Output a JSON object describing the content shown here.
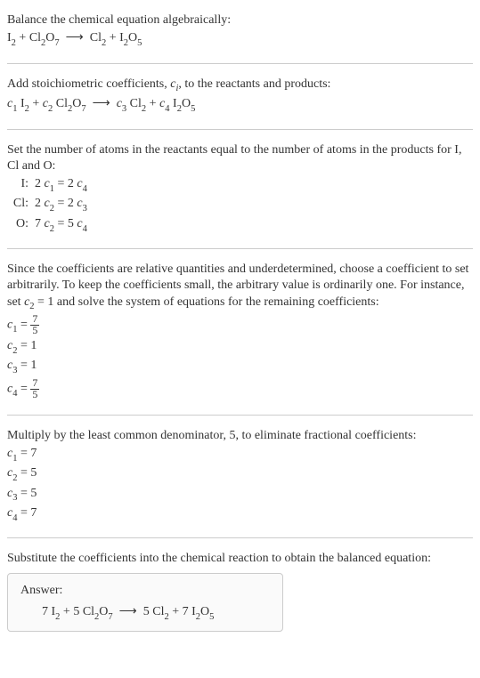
{
  "s1": {
    "intro": "Balance the chemical equation algebraically:",
    "eq_html": "I<span class=\"sub\">2</span> + Cl<span class=\"sub\">2</span>O<span class=\"sub\">7</span> &nbsp;⟶&nbsp; Cl<span class=\"sub\">2</span> + I<span class=\"sub\">2</span>O<span class=\"sub\">5</span>"
  },
  "s2": {
    "intro_html": "Add stoichiometric coefficients, <span class=\"italic\">c<span class=\"sub\">i</span></span>, to the reactants and products:",
    "eq_html": "<span class=\"italic\">c</span><span class=\"sub\">1</span> I<span class=\"sub\">2</span> + <span class=\"italic\">c</span><span class=\"sub\">2</span> Cl<span class=\"sub\">2</span>O<span class=\"sub\">7</span> &nbsp;⟶&nbsp; <span class=\"italic\">c</span><span class=\"sub\">3</span> Cl<span class=\"sub\">2</span> + <span class=\"italic\">c</span><span class=\"sub\">4</span> I<span class=\"sub\">2</span>O<span class=\"sub\">5</span>"
  },
  "s3": {
    "intro": "Set the number of atoms in the reactants equal to the number of atoms in the products for I, Cl and O:",
    "lines": [
      {
        "label": "I:",
        "rhs_html": "2 <span class=\"italic\">c</span><span class=\"sub\">1</span> = 2 <span class=\"italic\">c</span><span class=\"sub\">4</span>"
      },
      {
        "label": "Cl:",
        "rhs_html": "2 <span class=\"italic\">c</span><span class=\"sub\">2</span> = 2 <span class=\"italic\">c</span><span class=\"sub\">3</span>"
      },
      {
        "label": "O:",
        "rhs_html": "7 <span class=\"italic\">c</span><span class=\"sub\">2</span> = 5 <span class=\"italic\">c</span><span class=\"sub\">4</span>"
      }
    ]
  },
  "s4": {
    "intro_html": "Since the coefficients are relative quantities and underdetermined, choose a coefficient to set arbitrarily. To keep the coefficients small, the arbitrary value is ordinarily one. For instance, set <span class=\"italic\">c</span><span class=\"sub\">2</span> = 1 and solve the system of equations for the remaining coefficients:",
    "lines": [
      {
        "lhs_html": "<span class=\"italic\">c</span><span class=\"sub\">1</span> = <span class=\"frac\"><span class=\"num\">7</span><span class=\"den\">5</span></span>"
      },
      {
        "lhs_html": "<span class=\"italic\">c</span><span class=\"sub\">2</span> = 1"
      },
      {
        "lhs_html": "<span class=\"italic\">c</span><span class=\"sub\">3</span> = 1"
      },
      {
        "lhs_html": "<span class=\"italic\">c</span><span class=\"sub\">4</span> = <span class=\"frac\"><span class=\"num\">7</span><span class=\"den\">5</span></span>"
      }
    ]
  },
  "s5": {
    "intro": "Multiply by the least common denominator, 5, to eliminate fractional coefficients:",
    "lines": [
      {
        "lhs_html": "<span class=\"italic\">c</span><span class=\"sub\">1</span> = 7"
      },
      {
        "lhs_html": "<span class=\"italic\">c</span><span class=\"sub\">2</span> = 5"
      },
      {
        "lhs_html": "<span class=\"italic\">c</span><span class=\"sub\">3</span> = 5"
      },
      {
        "lhs_html": "<span class=\"italic\">c</span><span class=\"sub\">4</span> = 7"
      }
    ]
  },
  "s6": {
    "intro": "Substitute the coefficients into the chemical reaction to obtain the balanced equation:",
    "answer_label": "Answer:",
    "answer_html": "7 I<span class=\"sub\">2</span> + 5 Cl<span class=\"sub\">2</span>O<span class=\"sub\">7</span> &nbsp;⟶&nbsp; 5 Cl<span class=\"sub\">2</span> + 7 I<span class=\"sub\">2</span>O<span class=\"sub\">5</span>"
  },
  "chart_data": {
    "type": "table",
    "title": "Balancing I2 + Cl2O7 -> Cl2 + I2O5",
    "reactants": [
      "I2",
      "Cl2O7"
    ],
    "products": [
      "Cl2",
      "I2O5"
    ],
    "atom_balance": [
      {
        "element": "I",
        "lhs": "2 c1",
        "rhs": "2 c4"
      },
      {
        "element": "Cl",
        "lhs": "2 c2",
        "rhs": "2 c3"
      },
      {
        "element": "O",
        "lhs": "7 c2",
        "rhs": "5 c4"
      }
    ],
    "arbitrary_set": {
      "coefficient": "c2",
      "value": 1
    },
    "fractional_solution": {
      "c1": "7/5",
      "c2": 1,
      "c3": 1,
      "c4": "7/5"
    },
    "lcd": 5,
    "integer_solution": {
      "c1": 7,
      "c2": 5,
      "c3": 5,
      "c4": 7
    },
    "balanced_equation": "7 I2 + 5 Cl2O7 -> 5 Cl2 + 7 I2O5"
  }
}
